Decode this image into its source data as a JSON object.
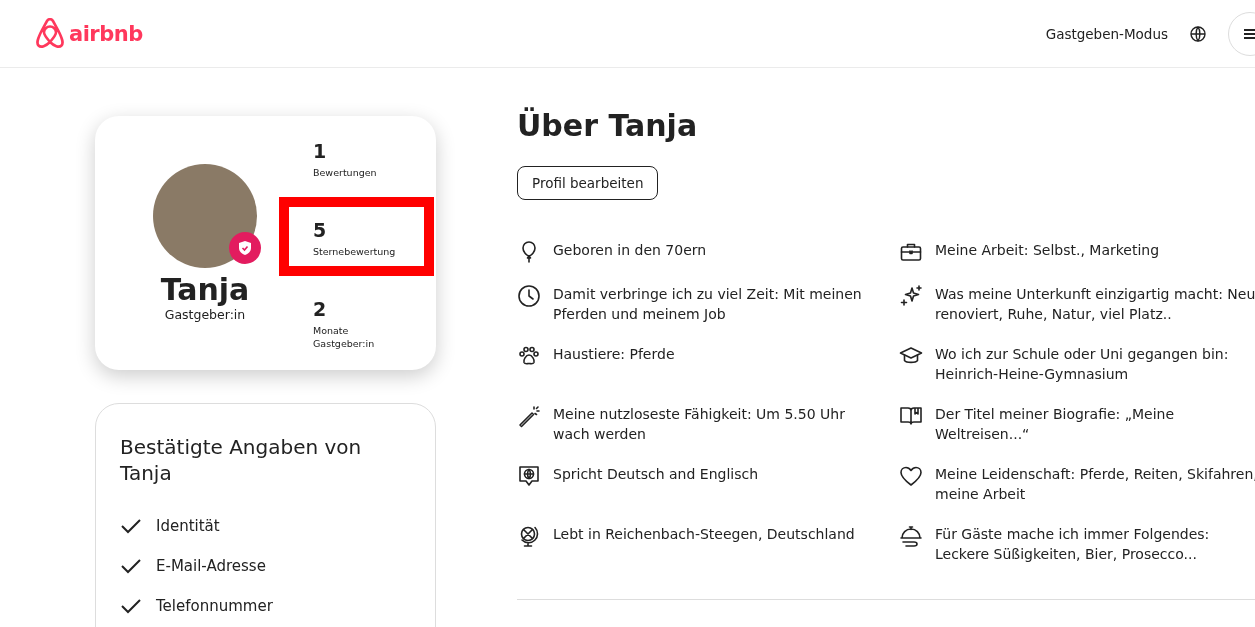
{
  "header": {
    "logo": "airbnb",
    "host_mode": "Gastgeben-Modus"
  },
  "profile_card": {
    "name": "Tanja",
    "role": "Gastgeber:in",
    "verified": true,
    "stats": [
      {
        "value": "1",
        "label": "Bewertungen",
        "highlighted": false
      },
      {
        "value": "5",
        "label": "Sternebewertung",
        "highlighted": true
      },
      {
        "value": "2",
        "label": "Monate Gastgeber:in",
        "highlighted": false
      }
    ]
  },
  "verified_card": {
    "title": "Bestätigte Angaben von Tanja",
    "items": [
      "Identität",
      "E-Mail-Adresse",
      "Telefonnummer"
    ]
  },
  "about": {
    "title": "Über Tanja",
    "edit_button": "Profil bearbeiten",
    "facts": [
      {
        "kind": "balloon",
        "text": "Geboren in den 70ern"
      },
      {
        "kind": "briefcase",
        "text": "Meine Arbeit: Selbst., Marketing"
      },
      {
        "kind": "clock",
        "text": "Damit verbringe ich zu viel Zeit: Mit meinen Pferden und meinem Job"
      },
      {
        "kind": "sparkles",
        "text": "Was meine Unterkunft einzigartig macht: Neu renoviert, Ruhe, Natur, viel Platz.."
      },
      {
        "kind": "paw",
        "text": "Haustiere: Pferde"
      },
      {
        "kind": "graduation",
        "text": "Wo ich zur Schule oder Uni gegangen bin: Heinrich-Heine-Gymnasium"
      },
      {
        "kind": "wand",
        "text": "Meine nutzloseste Fähigkeit: Um 5.50 Uhr wach werden"
      },
      {
        "kind": "book",
        "text": "Der Titel meiner Biografie: „Meine Weltreisen...“"
      },
      {
        "kind": "speech",
        "text": "Spricht Deutsch and Englisch"
      },
      {
        "kind": "heart",
        "text": "Meine Leidenschaft: Pferde, Reiten, Skifahren, meine Arbeit"
      },
      {
        "kind": "globe",
        "text": "Lebt in Reichenbach-Steegen, Deutschland"
      },
      {
        "kind": "cloche",
        "text": "Für Gäste mache ich immer Folgendes: Leckere Süßigkeiten, Bier, Prosecco..."
      }
    ]
  }
}
